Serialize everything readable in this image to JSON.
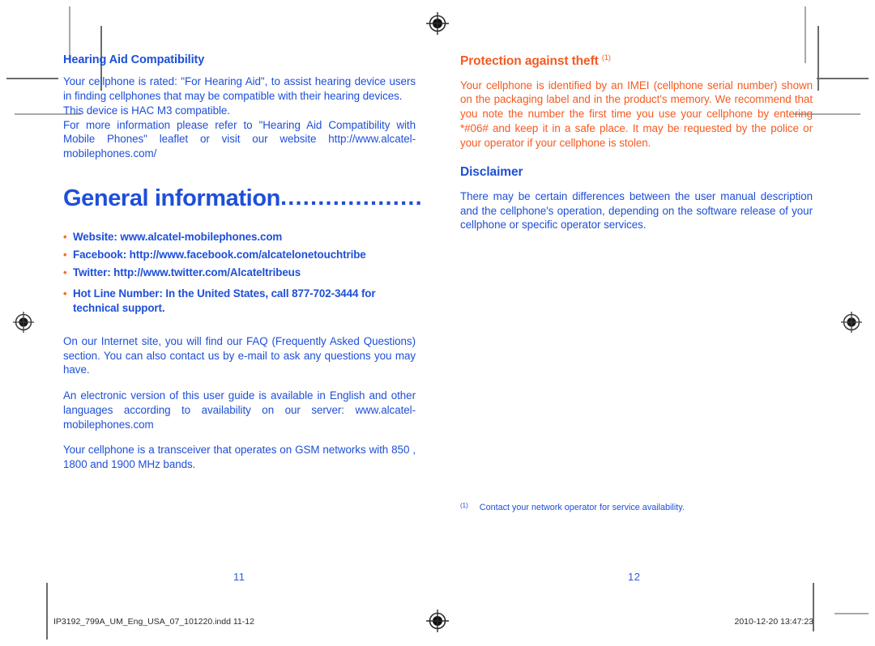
{
  "colors": {
    "blue": "#1e4fd8",
    "orange": "#f55a20",
    "bullet_orange": "#f07020",
    "mark_gray": "#6b6b6b"
  },
  "left_page": {
    "section_heading": "Hearing Aid Compatibility",
    "paragraphs": [
      "Your cellphone is rated: \"For Hearing Aid\", to assist hearing device users in finding cellphones that may be compatible with their hearing devices.",
      "This device is HAC M3 compatible.",
      "For more information please refer to \"Hearing Aid Compatibility with Mobile Phones\" leaflet or visit our website http://www.alcatel-mobilephones.com/"
    ],
    "chapter_title": "General information",
    "chapter_leader": "...................",
    "links": [
      {
        "bullet": "•",
        "text": "Website: www.alcatel-mobilephones.com"
      },
      {
        "bullet": "•",
        "text": "Facebook: http://www.facebook.com/alcatelonetouchtribe"
      },
      {
        "bullet": "•",
        "text": "Twitter: http://www.twitter.com/Alcateltribeus"
      },
      {
        "bullet": "•",
        "text": "Hot Line Number: In the United States, call 877-702-3444 for technical support."
      }
    ],
    "body_paragraphs": [
      "On our Internet site, you will find our FAQ (Frequently Asked Questions) section. You can also contact us by e-mail to ask any questions you may have.",
      "An electronic version of this user guide is available in English and other languages according to availability on our server: www.alcatel-mobilephones.com",
      "Your cellphone is a transceiver that operates on GSM networks with 850 , 1800 and 1900 MHz bands."
    ],
    "folio": "11"
  },
  "right_page": {
    "theft": {
      "heading": "Protection against theft",
      "heading_footnote": "(1)",
      "paragraph": "Your cellphone is identified by an IMEI (cellphone serial number) shown on the packaging label and in the product's memory. We recommend that you note the number the first time you use your cellphone by entering *#06# and keep it in a safe place.  It may be requested by the police or your operator if your cellphone is stolen."
    },
    "disclaimer": {
      "heading": "Disclaimer",
      "paragraph": "There may be certain differences between the user manual description and the cellphone's operation, depending on the software release of your cellphone or specific operator services."
    },
    "footnote": {
      "marker": "(1)",
      "text": "Contact your network operator for service availability."
    },
    "folio": "12"
  },
  "slug": {
    "filename": "IP3192_799A_UM_Eng_USA_07_101220.indd   11-12",
    "timestamp": "2010-12-20   13:47:23"
  },
  "marks": {
    "registration_icon": "registration-target-icon",
    "crop_icon": "crop-mark"
  }
}
